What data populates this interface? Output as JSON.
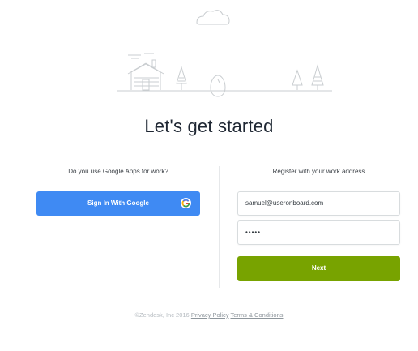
{
  "headline": "Let's get started",
  "google_section": {
    "prompt": "Do you use Google Apps for work?",
    "button_label": "Sign In With Google"
  },
  "register_section": {
    "prompt": "Register with your work address",
    "email_value": "samuel@useronboard.com",
    "password_mask": "•••••",
    "next_label": "Next"
  },
  "footer": {
    "copyright": "©Zendesk, Inc 2016",
    "privacy_link": "Privacy Policy",
    "terms_link": "Terms & Conditions"
  },
  "colors": {
    "google_button": "#3f8af3",
    "next_button": "#78a300",
    "headline": "#1f2733",
    "illustration_stroke": "#c9cdd0"
  },
  "icons": {
    "google": "google-g-icon",
    "illustration": "landscape-egg-illustration"
  }
}
